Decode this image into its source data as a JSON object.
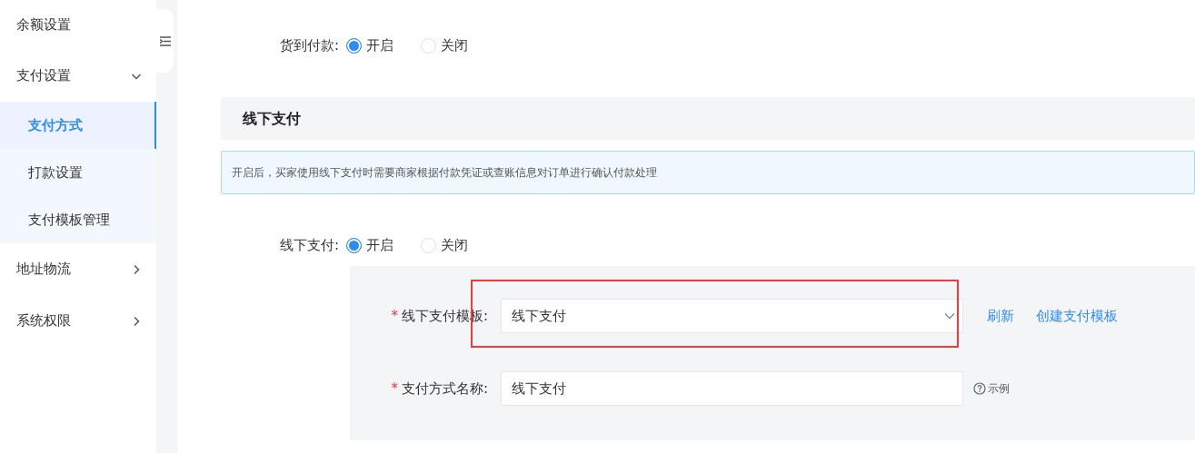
{
  "sidebar": {
    "items": [
      {
        "label": "余额设置"
      },
      {
        "label": "支付设置",
        "expanded": true,
        "children": [
          {
            "label": "支付方式",
            "selected": true
          },
          {
            "label": "打款设置",
            "selected": false
          },
          {
            "label": "支付模板管理",
            "selected": false
          }
        ]
      },
      {
        "label": "地址物流",
        "expanded": false
      },
      {
        "label": "系统权限",
        "expanded": false
      }
    ]
  },
  "cod": {
    "label": "货到付款:",
    "options": [
      {
        "label": "开启",
        "selected": true
      },
      {
        "label": "关闭",
        "selected": false
      }
    ]
  },
  "section": {
    "title": "线下支付",
    "notice": "开启后，买家使用线下支付时需要商家根据付款凭证或查账信息对订单进行确认付款处理"
  },
  "offline": {
    "label": "线下支付:",
    "options": [
      {
        "label": "开启",
        "selected": true
      },
      {
        "label": "关闭",
        "selected": false
      }
    ]
  },
  "form": {
    "fields": [
      {
        "kind": "select",
        "required_mark": "*",
        "label": "线下支付模板:",
        "value": "线下支付",
        "links": [
          "刷新",
          "创建支付模板"
        ],
        "annotated": true
      },
      {
        "kind": "text",
        "required_mark": "*",
        "label": "支付方式名称:",
        "value": "线下支付",
        "hint": "示例"
      }
    ]
  }
}
